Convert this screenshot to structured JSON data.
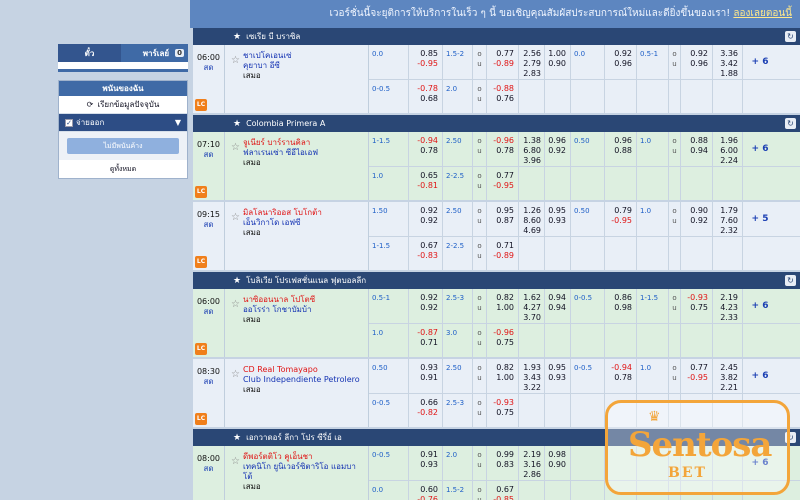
{
  "banner": {
    "text": "เวอร์ชั่นนี้จะยุติการให้บริการในเร็ว ๆ นี้ ขอเชิญคุณสัมผัสประสบการณ์ใหม่และดียิ่งขึ้นของเรา!",
    "link": "ลองเลยตอนนี้"
  },
  "sidebar": {
    "tab_single": "ตั๋ว",
    "tab_parlay": "พาร์เลย์",
    "parlay_count": "0",
    "bet_list_title": "พนันของฉัน",
    "refresh_label": "เรียกข้อมูลปัจจุบัน",
    "paid_label": "จ่ายออก",
    "no_bets": "ไม่มีพนันค้าง",
    "view_all": "ดูทั้งหมด"
  },
  "badge": "LC",
  "leagues": [
    {
      "name": "เซเรีย บี บราซิล",
      "matches": [
        {
          "time": "06:00",
          "status": "สด",
          "home": "ชาเปโคเอนเซ่",
          "away": "คุยาบา อีซี",
          "draw": "เสมอ",
          "home_color": "blue",
          "bg": "blue",
          "more": "+ 6",
          "rows": [
            {
              "hdp": "0.0",
              "h1": "0.85",
              "h2": "-0.95",
              "line": "1.5-2",
              "ou": "o|u",
              "o1": "0.77",
              "o2": "-0.89",
              "x1": "2.56",
              "x2": "2.79",
              "x3": "2.83",
              "y1": "1.00",
              "y2": "0.90",
              "fh": "0.0",
              "f1": "0.92",
              "f2": "0.96",
              "fl": "0.5-1",
              "fou": "o|u",
              "g1": "0.92",
              "g2": "0.96",
              "z1": "3.36",
              "z2": "3.42",
              "z3": "1.88"
            },
            {
              "hdp": "0-0.5",
              "h1": "-0.78",
              "h2": "0.68",
              "line": "2.0",
              "ou": "o|u",
              "o1": "-0.88",
              "o2": "0.76"
            }
          ]
        }
      ]
    },
    {
      "name": "Colombia Primera A",
      "matches": [
        {
          "time": "07:10",
          "status": "สด",
          "home": "จูเนียร์ บาร์รานคิลา",
          "away": "ฟลาเรนเซ่า ซีอีไอเอฟ",
          "draw": "เสมอ",
          "home_color": "red",
          "bg": "green",
          "more": "+ 6",
          "rows": [
            {
              "hdp": "1-1.5",
              "h1": "-0.94",
              "h2": "0.78",
              "line": "2.50",
              "ou": "o|u",
              "o1": "-0.96",
              "o2": "0.78",
              "x1": "1.38",
              "x2": "6.80",
              "x3": "3.96",
              "y1": "0.96",
              "y2": "0.92",
              "fh": "0.50",
              "f1": "0.96",
              "f2": "0.88",
              "fl": "1.0",
              "fou": "o|u",
              "g1": "0.88",
              "g2": "0.94",
              "z1": "1.96",
              "z2": "6.00",
              "z3": "2.24"
            },
            {
              "hdp": "1.0",
              "h1": "0.65",
              "h2": "-0.81",
              "line": "2-2.5",
              "ou": "o|u",
              "o1": "0.77",
              "o2": "-0.95"
            }
          ]
        },
        {
          "time": "09:15",
          "status": "สด",
          "home": "มิลโลนาริออส โบโกต้า",
          "away": "เอ็นวิกาโด เอฟซี",
          "draw": "เสมอ",
          "home_color": "red",
          "bg": "blue",
          "more": "+ 5",
          "rows": [
            {
              "hdp": "1.50",
              "h1": "0.92",
              "h2": "0.92",
              "line": "2.50",
              "ou": "o|u",
              "o1": "0.95",
              "o2": "0.87",
              "x1": "1.26",
              "x2": "8.60",
              "x3": "4.69",
              "y1": "0.95",
              "y2": "0.93",
              "fh": "0.50",
              "f1": "0.79",
              "f2": "-0.95",
              "fl": "1.0",
              "fou": "o|u",
              "g1": "0.90",
              "g2": "0.92",
              "z1": "1.79",
              "z2": "7.60",
              "z3": "2.32"
            },
            {
              "hdp": "1-1.5",
              "h1": "0.67",
              "h2": "-0.83",
              "line": "2-2.5",
              "ou": "o|u",
              "o1": "0.71",
              "o2": "-0.89"
            }
          ]
        }
      ]
    },
    {
      "name": "โบลิเวีย โปรเฟสชั่นแนล ฟุตบอลลีก",
      "matches": [
        {
          "time": "06:00",
          "status": "สด",
          "home": "นาซิออนนาล โปโตซี",
          "away": "ออโรร่า โกชาบัมบ้า",
          "draw": "เสมอ",
          "home_color": "red",
          "bg": "green",
          "more": "+ 6",
          "rows": [
            {
              "hdp": "0.5-1",
              "h1": "0.92",
              "h2": "0.92",
              "line": "2.5-3",
              "ou": "o|u",
              "o1": "0.82",
              "o2": "1.00",
              "x1": "1.62",
              "x2": "4.27",
              "x3": "3.70",
              "y1": "0.94",
              "y2": "0.94",
              "fh": "0-0.5",
              "f1": "0.86",
              "f2": "0.98",
              "fl": "1-1.5",
              "fou": "o|u",
              "g1": "-0.93",
              "g2": "0.75",
              "z1": "2.19",
              "z2": "4.23",
              "z3": "2.33"
            },
            {
              "hdp": "1.0",
              "h1": "-0.87",
              "h2": "0.71",
              "line": "3.0",
              "ou": "o|u",
              "o1": "-0.96",
              "o2": "0.75"
            }
          ]
        },
        {
          "time": "08:30",
          "status": "สด",
          "home": "CD Real Tomayapo",
          "away": "Club Independiente Petrolero",
          "draw": "เสมอ",
          "home_color": "red",
          "bg": "blue",
          "more": "+ 6",
          "rows": [
            {
              "hdp": "0.50",
              "h1": "0.93",
              "h2": "0.91",
              "line": "2.50",
              "ou": "o|u",
              "o1": "0.82",
              "o2": "1.00",
              "x1": "1.93",
              "x2": "3.43",
              "x3": "3.22",
              "y1": "0.95",
              "y2": "0.93",
              "fh": "0-0.5",
              "f1": "-0.94",
              "f2": "0.78",
              "fl": "1.0",
              "fou": "o|u",
              "g1": "0.77",
              "g2": "-0.95",
              "z1": "2.45",
              "z2": "3.82",
              "z3": "2.21"
            },
            {
              "hdp": "0-0.5",
              "h1": "0.66",
              "h2": "-0.82",
              "line": "2.5-3",
              "ou": "o|u",
              "o1": "-0.93",
              "o2": "0.75"
            }
          ]
        }
      ]
    },
    {
      "name": "เอกวาดอร์ ลีกา โปร ซีรี่ย์ เอ",
      "matches": [
        {
          "time": "08:00",
          "status": "สด",
          "home": "ดีพอร์ตติโว คูเอ็นชา",
          "away": "เทคนิโก ยูนิเวอร์ซิตาริโอ แอมบาโต้",
          "draw": "เสมอ",
          "home_color": "red",
          "bg": "green",
          "more": "+ 6",
          "rows": [
            {
              "hdp": "0-0.5",
              "h1": "0.91",
              "h2": "0.93",
              "line": "2.0",
              "ou": "o|u",
              "o1": "0.99",
              "o2": "0.83",
              "x1": "2.19",
              "x2": "3.16",
              "x3": "2.86",
              "y1": "0.98",
              "y2": "0.90",
              "fh": "",
              "f1": "",
              "f2": "",
              "fl": "",
              "fou": "",
              "g1": "",
              "g2": "",
              "z1": "",
              "z2": "",
              "z3": ""
            },
            {
              "hdp": "0.0",
              "h1": "0.60",
              "h2": "-0.76",
              "line": "1.5-2",
              "ou": "o|u",
              "o1": "0.67",
              "o2": "-0.85"
            }
          ]
        }
      ]
    }
  ],
  "logo": {
    "brand": "Sentosa",
    "sub": "BET"
  },
  "colors": {
    "header": "#2a4775",
    "row_blue": "#e9eff7",
    "row_green": "#ddefe0",
    "negative": "#e01515",
    "live": "#1b3fb3",
    "badge": "#f07f1b",
    "logo": "#f3a53a"
  }
}
